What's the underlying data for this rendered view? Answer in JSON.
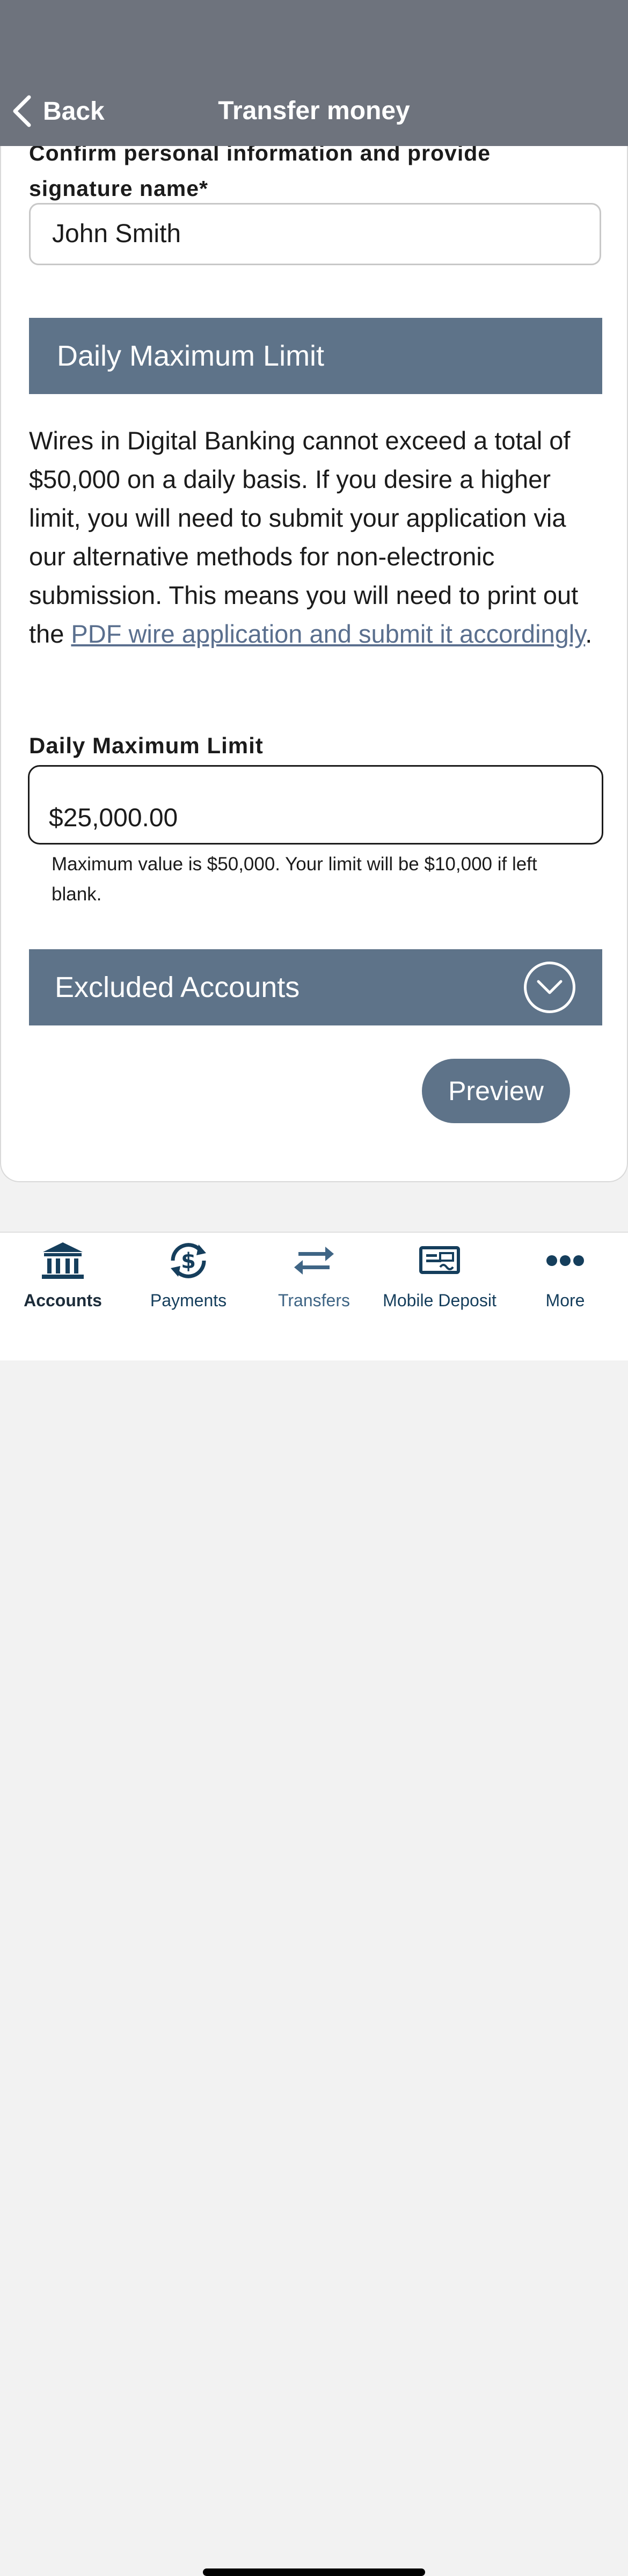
{
  "header": {
    "back_label": "Back",
    "title": "Transfer money"
  },
  "signature": {
    "label": "Confirm personal information and provide signature name*",
    "value": "John Smith"
  },
  "daily_limit_section": {
    "title": "Daily Maximum Limit",
    "description_before_link": "Wires in Digital Banking cannot exceed a total of $50,000 on a daily basis. If you desire a higher limit, you will need to submit your application via our alternative methods for non-electronic submission. This means you will need to print out the ",
    "link_text": "PDF wire application and submit it accordingly",
    "description_after_link": ".",
    "field_label": "Daily Maximum Limit",
    "field_value": "$25,000.00",
    "hint": "Maximum value is $50,000. Your limit will be $10,000 if left blank."
  },
  "excluded_section": {
    "title": "Excluded Accounts"
  },
  "preview_label": "Preview",
  "tabbar": {
    "items": [
      {
        "label": "Accounts",
        "icon": "bank-icon",
        "active": true
      },
      {
        "label": "Payments",
        "icon": "dollar-cycle-icon",
        "active": false
      },
      {
        "label": "Transfers",
        "icon": "transfer-arrows-icon",
        "active": false
      },
      {
        "label": "Mobile Deposit",
        "icon": "check-icon",
        "active": false
      },
      {
        "label": "More",
        "icon": "more-dots-icon",
        "active": false
      }
    ]
  },
  "colors": {
    "header_bg": "#6e737d",
    "section_bg": "#5e7389",
    "link": "#5a6f8e",
    "tab_icon": "#153e5c"
  }
}
